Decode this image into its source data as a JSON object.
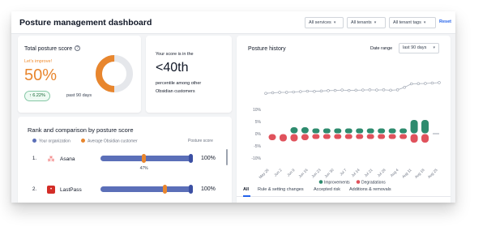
{
  "header": {
    "title": "Posture management dashboard",
    "filters": [
      "All services",
      "All tenants",
      "All tenant tags"
    ],
    "reset_label": "Reset"
  },
  "total_score": {
    "title": "Total posture score",
    "info_glyph": "?",
    "status": "Let's improve!",
    "score": "50%",
    "score_fraction": 0.5,
    "delta": "6.22%",
    "delta_icon": "arrow-up-icon",
    "period": "past 90 days",
    "colors": {
      "fill": "#e8862e",
      "track": "#e5e7eb"
    }
  },
  "percentile": {
    "line1": "Your score is in the",
    "value": "<40th",
    "line3": "percentile among other",
    "line4": "Obsidian customers"
  },
  "rank": {
    "title": "Rank and comparison by posture score",
    "legend": [
      {
        "label": "Your organization",
        "color": "#5b6fb8"
      },
      {
        "label": "Average Obsidian customer",
        "color": "#e8862e"
      },
      {
        "label": "Posture score",
        "color": ""
      }
    ],
    "rows": [
      {
        "num": "1.",
        "name": "Asana",
        "logo_color": "#f06a6a",
        "logo_glyph": "⁂",
        "avg_fraction": 0.47,
        "avg_label": "47%",
        "org_fraction": 1.0,
        "pct": "100%"
      },
      {
        "num": "2.",
        "name": "LastPass",
        "logo_color": "#d32d27",
        "logo_glyph": "•",
        "avg_fraction": 0.7,
        "avg_label": "",
        "org_fraction": 1.0,
        "pct": "100%"
      }
    ]
  },
  "history": {
    "title": "Posture history",
    "date_range_label": "Date range",
    "date_range_value": "last 90 days",
    "tabs": [
      "All",
      "Rule & setting changes",
      "Accepted risk",
      "Additions & removals"
    ],
    "active_tab": 0
  },
  "chart_data": {
    "type": "line",
    "title": "Posture history",
    "x": [
      "May 26",
      "Jun 2",
      "Jun 9",
      "Jun 16",
      "Jun 23",
      "Jun 30",
      "Jul 7",
      "Jul 14",
      "Jul 21",
      "Jul 28",
      "Aug 4",
      "Aug 11",
      "Aug 18",
      "Aug 25"
    ],
    "line": {
      "name": "Posture score",
      "color": "#9ca3af",
      "values": [
        44.5,
        44.8,
        45.0,
        45.0,
        45.2,
        45.4,
        45.6,
        45.5,
        45.7,
        45.9,
        46.0,
        46.2,
        46.0,
        46.1,
        46.2,
        46.3,
        46.2,
        46.3,
        46.1,
        46.3,
        47.6,
        49.4,
        49.5,
        49.6,
        49.8,
        50.0
      ]
    },
    "bars": {
      "series": [
        {
          "name": "Improvements",
          "color": "#2e8b6e",
          "values": [
            0,
            0,
            2.5,
            2.5,
            2,
            2,
            2,
            2,
            2,
            2,
            2,
            2,
            2,
            5.5,
            5.5,
            0
          ]
        },
        {
          "name": "Degradations",
          "color": "#e0525c",
          "values": [
            -2.5,
            -3,
            -3,
            -2.5,
            -2,
            -2,
            -2,
            -2,
            -2,
            -2,
            -2,
            -2,
            -2,
            -3.5,
            -3.5,
            0
          ]
        }
      ]
    },
    "y_ticks": [
      "10%",
      "5%",
      "0%",
      "-5%",
      "-10%"
    ],
    "ylim": [
      -10,
      10
    ],
    "legend": [
      "Improvements",
      "Degradations"
    ],
    "legend_position": "bottom"
  }
}
